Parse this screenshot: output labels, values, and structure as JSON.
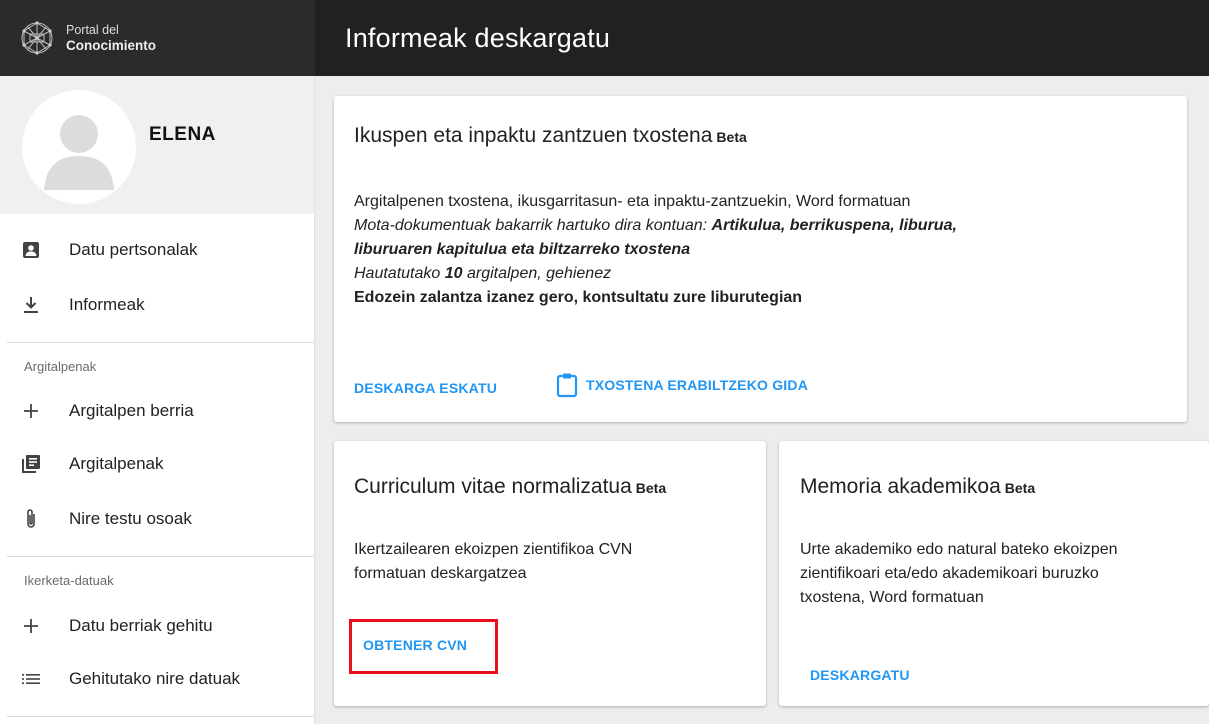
{
  "app": {
    "brand_line1": "Portal del",
    "brand_line2": "Conocimiento",
    "page_title": "Informeak deskargatu"
  },
  "sidebar": {
    "user_name": "ELENA",
    "items": [
      {
        "label": "Datu pertsonalak",
        "icon": "account-box-icon"
      },
      {
        "label": "Informeak",
        "icon": "download-icon"
      }
    ],
    "sections": [
      {
        "label": "Argitalpenak",
        "items": [
          {
            "label": "Argitalpen berria",
            "icon": "plus-icon"
          },
          {
            "label": "Argitalpenak",
            "icon": "library-books-icon"
          },
          {
            "label": "Nire testu osoak",
            "icon": "paperclip-icon"
          }
        ]
      },
      {
        "label": "Ikerketa-datuak",
        "items": [
          {
            "label": "Datu berriak gehitu",
            "icon": "plus-icon"
          },
          {
            "label": "Gehitutako nire datuak",
            "icon": "list-icon"
          }
        ]
      }
    ]
  },
  "cards": {
    "impact": {
      "title": "Ikuspen eta inpaktu zantzuen txostena",
      "beta": "Beta",
      "line1": "Argitalpenen txostena, ikusgarritasun- eta inpaktu-zantzuekin, Word formatuan",
      "line2_prefix": "Mota-dokumentuak bakarrik hartuko dira kontuan: ",
      "line2_bold": "Artikulua, berrikuspena, liburua,",
      "line3_bold": "liburuaren kapitulua eta biltzarreko txostena",
      "line4_prefix": "Hautatutako ",
      "line4_bold": "10",
      "line4_suffix": " argitalpen, gehienez",
      "line5": "Edozein zalantza izanez gero, kontsultatu zure liburutegian",
      "action1": "DESKARGA ESKATU",
      "action2": "TXOSTENA ERABILTZEKO GIDA"
    },
    "cv": {
      "title": "Curriculum vitae normalizatua",
      "beta": "Beta",
      "line1": "Ikertzailearen ekoizpen zientifikoa CVN",
      "line2": "formatuan deskargatzea",
      "action": "OBTENER CVN"
    },
    "memoria": {
      "title": "Memoria akademikoa",
      "beta": "Beta",
      "line1": "Urte akademiko edo natural bateko ekoizpen",
      "line2": "zientifikoari eta/edo akademikoari buruzko",
      "line3": "txostena, Word formatuan",
      "action": "DESKARGATU"
    }
  },
  "colors": {
    "topbar": "#212121",
    "accent": "#2196f3",
    "highlight": "#e8101e"
  }
}
